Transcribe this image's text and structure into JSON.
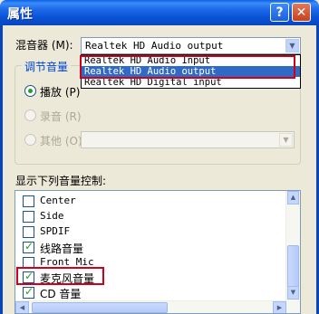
{
  "window": {
    "title": "属性",
    "help_glyph": "?",
    "close_glyph": "✕"
  },
  "mixer": {
    "label": "混音器 (M):",
    "selected": "Realtek HD Audio output",
    "options": [
      "Realtek HD Audio Input",
      "Realtek HD Audio output",
      "Realtek HD Digital input"
    ],
    "highlighted_index": 1
  },
  "volume_group": {
    "title": "调节音量",
    "playback": "播放 (P)",
    "record": "录音 (R)",
    "other": "其他 (O)",
    "selected": "playback"
  },
  "controls": {
    "label": "显示下列音量控制:",
    "items": [
      {
        "label": "Center",
        "checked": false
      },
      {
        "label": "Side",
        "checked": false
      },
      {
        "label": "SPDIF",
        "checked": false
      },
      {
        "label": "线路音量",
        "checked": true
      },
      {
        "label": "Front Mic",
        "checked": false
      },
      {
        "label": "麦克风音量",
        "checked": true
      },
      {
        "label": "CD 音量",
        "checked": true
      }
    ]
  },
  "colors": {
    "titlebar": "#0A52D6",
    "selection": "#316AC5",
    "highlight_box": "#D0001C",
    "check": "#21A121"
  }
}
